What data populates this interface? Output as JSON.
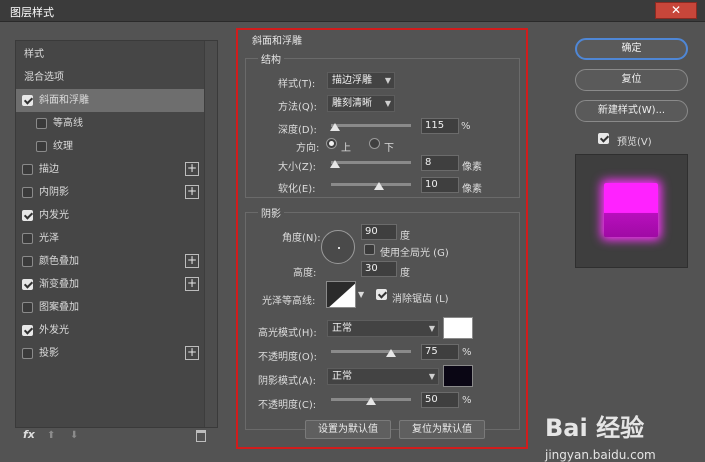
{
  "window": {
    "title": "图层样式",
    "close": "✕"
  },
  "left_panel": {
    "items": [
      {
        "label": "样式",
        "checkbox": false,
        "plus": false,
        "indent": 0,
        "selected": false
      },
      {
        "label": "混合选项",
        "checkbox": false,
        "plus": false,
        "indent": 0,
        "selected": false
      },
      {
        "label": "斜面和浮雕",
        "checkbox": true,
        "checked": true,
        "plus": false,
        "indent": 0,
        "selected": true
      },
      {
        "label": "等高线",
        "checkbox": true,
        "checked": false,
        "plus": false,
        "indent": 1,
        "selected": false
      },
      {
        "label": "纹理",
        "checkbox": true,
        "checked": false,
        "plus": false,
        "indent": 1,
        "selected": false
      },
      {
        "label": "描边",
        "checkbox": true,
        "checked": false,
        "plus": true,
        "indent": 0,
        "selected": false
      },
      {
        "label": "内阴影",
        "checkbox": true,
        "checked": false,
        "plus": true,
        "indent": 0,
        "selected": false
      },
      {
        "label": "内发光",
        "checkbox": true,
        "checked": true,
        "plus": false,
        "indent": 0,
        "selected": false
      },
      {
        "label": "光泽",
        "checkbox": true,
        "checked": false,
        "plus": false,
        "indent": 0,
        "selected": false
      },
      {
        "label": "颜色叠加",
        "checkbox": true,
        "checked": false,
        "plus": true,
        "indent": 0,
        "selected": false
      },
      {
        "label": "渐变叠加",
        "checkbox": true,
        "checked": true,
        "plus": true,
        "indent": 0,
        "selected": false
      },
      {
        "label": "图案叠加",
        "checkbox": true,
        "checked": false,
        "plus": false,
        "indent": 0,
        "selected": false
      },
      {
        "label": "外发光",
        "checkbox": true,
        "checked": true,
        "plus": false,
        "indent": 0,
        "selected": false
      },
      {
        "label": "投影",
        "checkbox": true,
        "checked": false,
        "plus": true,
        "indent": 0,
        "selected": false
      }
    ],
    "footer": {
      "fx": "fx",
      "up": "⬆",
      "down": "⬇"
    }
  },
  "bevel": {
    "section_title": "斜面和浮雕",
    "structure_title": "结构",
    "style_label": "样式(T):",
    "style_value": "描边浮雕",
    "technique_label": "方法(Q):",
    "technique_value": "雕刻清晰",
    "depth_label": "深度(D):",
    "depth_value": "115",
    "depth_unit": "%",
    "depth_level": 0.05,
    "direction_label": "方向:",
    "direction_up": "上",
    "direction_down": "下",
    "size_label": "大小(Z):",
    "size_value": "8",
    "size_unit": "像素",
    "size_level": 0.05,
    "soften_label": "软化(E):",
    "soften_value": "10",
    "soften_unit": "像素",
    "soften_level": 0.6
  },
  "shading": {
    "title": "阴影",
    "angle_label": "角度(N):",
    "angle_value": "90",
    "angle_unit": "度",
    "global_light_label": "使用全局光 (G)",
    "altitude_label": "高度:",
    "altitude_value": "30",
    "altitude_unit": "度",
    "gloss_contour_label": "光泽等高线:",
    "anti_alias_label": "消除锯齿 (L)",
    "highlight_mode_label": "高光模式(H):",
    "highlight_mode_value": "正常",
    "highlight_color": "#ffffff",
    "highlight_opacity_label": "不透明度(O):",
    "highlight_opacity_value": "75",
    "highlight_opacity_unit": "%",
    "highlight_opacity_level": 0.75,
    "shadow_mode_label": "阴影模式(A):",
    "shadow_mode_value": "正常",
    "shadow_color": "#0a0614",
    "shadow_opacity_label": "不透明度(C):",
    "shadow_opacity_value": "50",
    "shadow_opacity_unit": "%",
    "shadow_opacity_level": 0.5,
    "make_default": "设置为默认值",
    "reset_default": "复位为默认值"
  },
  "right_panel": {
    "ok": "确定",
    "reset": "复位",
    "new_style": "新建样式(W)...",
    "preview_label": "预览(V)",
    "preview_color": "#ff22ff"
  },
  "watermark": {
    "brand": "Bai  经验",
    "url": "jingyan.baidu.com"
  }
}
